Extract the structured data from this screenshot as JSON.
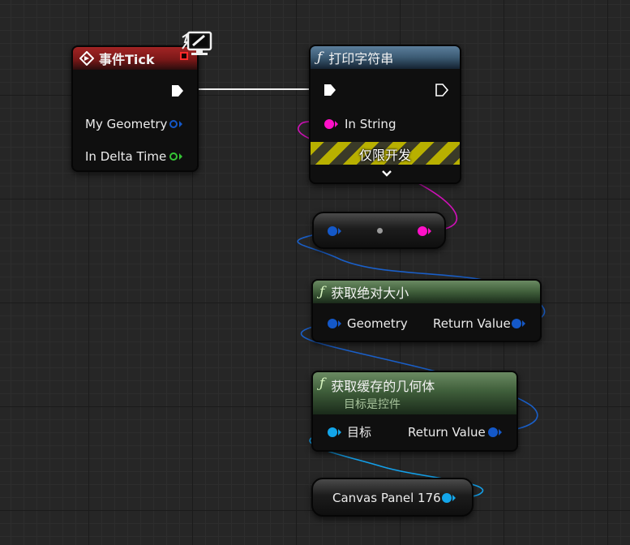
{
  "colors": {
    "event_header": "#8e1d1d",
    "print_header": "#41627d",
    "pure_header": "#3f5d3a",
    "exec_wire": "#f0f0f0",
    "string_pin": "#ff10c8",
    "struct_pin": "#1458c8",
    "float_pin": "#35c535",
    "object_pin": "#13a6ea"
  },
  "event_tick": {
    "title": "事件Tick",
    "icon": "event-diamond-icon",
    "corner_icon": "monitor-client-icon",
    "pins": {
      "my_geometry": "My Geometry",
      "in_delta_time": "In Delta Time"
    }
  },
  "print_string": {
    "title": "打印字符串",
    "in_string_label": "In String",
    "dev_only_label": "仅限开发",
    "expand_icon": "chevron-down-icon"
  },
  "reroute": {
    "icon": "reroute-dot-icon"
  },
  "get_absolute_size": {
    "title": "获取绝对大小",
    "input_label": "Geometry",
    "output_label": "Return Value"
  },
  "get_cached_geometry": {
    "title": "获取缓存的几何体",
    "subtitle": "目标是控件",
    "input_label": "目标",
    "output_label": "Return Value"
  },
  "canvas_panel_ref": {
    "label": "Canvas Panel 176"
  }
}
